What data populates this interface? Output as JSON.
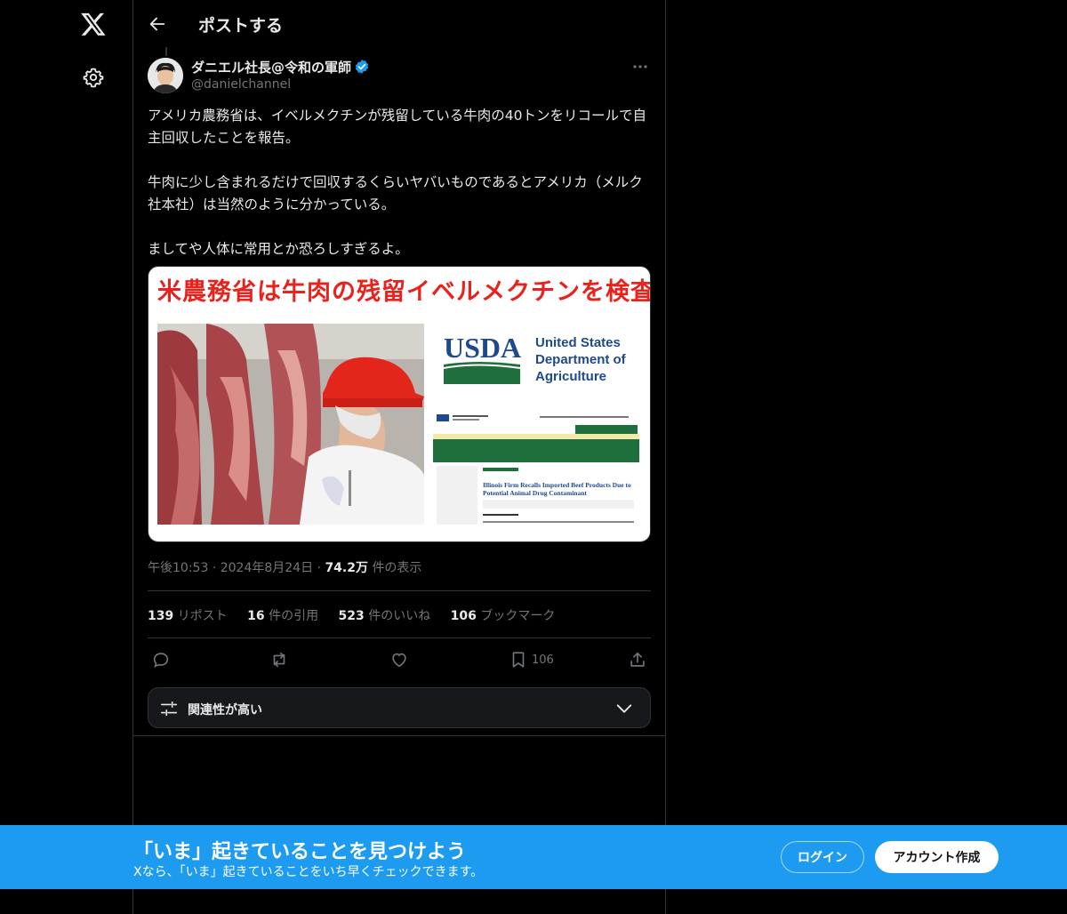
{
  "header": {
    "title": "ポストする"
  },
  "author": {
    "name": "ダニエル社長@令和の軍師",
    "handle": "@danielchannel"
  },
  "tweet": {
    "paragraphs": [
      "アメリカ農務省は、イベルメクチンが残留している牛肉の40トンをリコールで自主回収したことを報告。",
      "牛肉に少し含まれるだけで回収するくらいヤバいものであるとアメリカ（メルク社本社）は当然のように分かっている。",
      "ましてや人体に常用とか恐ろしすぎるよ。"
    ]
  },
  "media": {
    "headline": "米農務省は牛肉の残留イベルメクチンを検査",
    "logo_text": "USDA",
    "org_line1": "United States",
    "org_line2": "Department of",
    "org_line3": "Agriculture",
    "article_title": "Illinois Firm Recalls Imported Beef Products Due to Potential Animal Drug Contaminant"
  },
  "meta": {
    "time": "午後10:53",
    "date": "2024年8月24日",
    "views_value": "74.2万",
    "views_label": "件の表示"
  },
  "stats": {
    "reposts_value": "139",
    "reposts_label": "リポスト",
    "quotes_value": "16",
    "quotes_label": "件の引用",
    "likes_value": "523",
    "likes_label": "件のいいね",
    "bookmarks_value": "106",
    "bookmarks_label": "ブックマーク"
  },
  "actions": {
    "bookmark_count": "106"
  },
  "sort": {
    "label": "関連性が高い"
  },
  "banner": {
    "title": "「いま」起きていることを見つけよう",
    "subtitle": "Xなら、「いま」起きていることをいち早くチェックできます。",
    "login_label": "ログイン",
    "signup_label": "アカウント作成"
  },
  "icons": {
    "logo": "x-logo-icon",
    "settings": "gear-icon",
    "back": "arrow-left-icon",
    "verified": "verified-badge-icon",
    "more": "more-dots-icon",
    "reply": "reply-icon",
    "repost": "repost-icon",
    "like": "heart-icon",
    "bookmark": "bookmark-icon",
    "share": "share-icon",
    "sort": "sliders-icon",
    "chevron": "chevron-down-icon"
  },
  "colors": {
    "accent": "#1d9bf0",
    "background": "#000000",
    "text": "#e7e9ea",
    "muted": "#71767b",
    "headline_red": "#e8221c",
    "usda_blue": "#1e4a8c",
    "usda_green": "#1f6f3c"
  }
}
